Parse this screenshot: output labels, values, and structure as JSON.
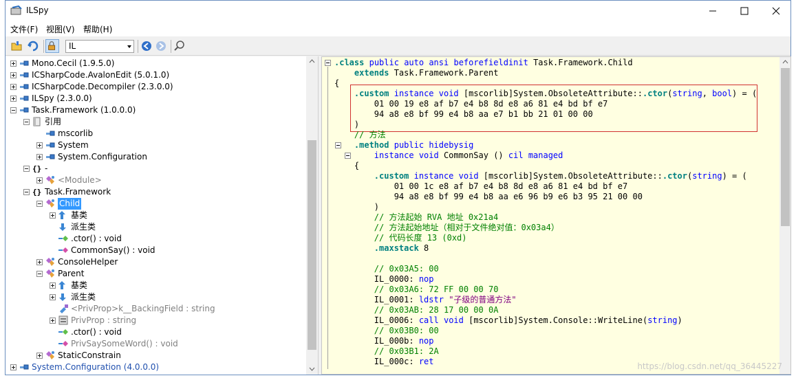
{
  "window": {
    "title": "ILSpy"
  },
  "menu": [
    {
      "label": "文件(F)"
    },
    {
      "label": "视图(V)"
    },
    {
      "label": "帮助(H)"
    }
  ],
  "toolbar": {
    "language": "IL"
  },
  "tree": [
    {
      "label": "Mono.Cecil (1.9.5.0)"
    },
    {
      "label": "ICSharpCode.AvalonEdit (5.0.1.0)"
    },
    {
      "label": "ICSharpCode.Decompiler (2.3.0.0)"
    },
    {
      "label": "ILSpy (2.3.0.0)"
    },
    {
      "label": "Task.Framework (1.0.0.0)"
    },
    {
      "label": "引用"
    },
    {
      "label": "mscorlib"
    },
    {
      "label": "System"
    },
    {
      "label": "System.Configuration"
    },
    {
      "label": "-"
    },
    {
      "label": "<Module>"
    },
    {
      "label": "Task.Framework"
    },
    {
      "label": "Child"
    },
    {
      "label": "基类"
    },
    {
      "label": "派生类"
    },
    {
      "label": ".ctor() : void"
    },
    {
      "label": "CommonSay() : void"
    },
    {
      "label": "ConsoleHelper"
    },
    {
      "label": "Parent"
    },
    {
      "label": "基类"
    },
    {
      "label": "派生类"
    },
    {
      "label": "<PrivProp>k__BackingField : string"
    },
    {
      "label": "PrivProp : string"
    },
    {
      "label": ".ctor() : void"
    },
    {
      "label": "PrivSaySomeWord() : void"
    },
    {
      "label": "StaticConstrain"
    },
    {
      "label": "System.Configuration (4.0.0.0)"
    }
  ],
  "code": [
    ".class public auto ansi beforefieldinit Task.Framework.Child",
    "    extends Task.Framework.Parent",
    "{",
    "    .custom instance void [mscorlib]System.ObsoleteAttribute::.ctor(string, bool) = (",
    "        01 00 19 e8 af b7 e4 b8 8d e8 a6 81 e4 bd bf e7",
    "        94 a8 e8 bf 99 e4 b8 aa e7 b1 bb 21 01 00 00",
    "    )",
    "    // 方法",
    "    .method public hidebysig",
    "        instance void CommonSay () cil managed",
    "    {",
    "        .custom instance void [mscorlib]System.ObsoleteAttribute::.ctor(string) = (",
    "            01 00 1c e8 af b7 e4 b8 8d e8 a6 81 e4 bd bf e7",
    "            94 a8 e8 bf 99 e4 b8 aa e6 96 b9 e6 b3 95 21 00 00",
    "        )",
    "        // 方法起始 RVA 地址 0x21a4",
    "        // 方法起始地址（相对于文件绝对值：0x03a4）",
    "        // 代码长度 13 (0xd)",
    "        .maxstack 8",
    "",
    "        // 0x03A5: 00",
    "        IL_0000: nop",
    "        // 0x03A6: 72 FF 00 00 70",
    "        IL_0001: ldstr \"子级的普通方法\"",
    "        // 0x03AB: 28 17 00 00 0A",
    "        IL_0006: call void [mscorlib]System.Console::WriteLine(string)",
    "        // 0x03B0: 00",
    "        IL_000b: nop",
    "        // 0x03B1: 2A",
    "        IL_000c: ret"
  ],
  "watermark": "https://blog.csdn.net/qq_36445227"
}
